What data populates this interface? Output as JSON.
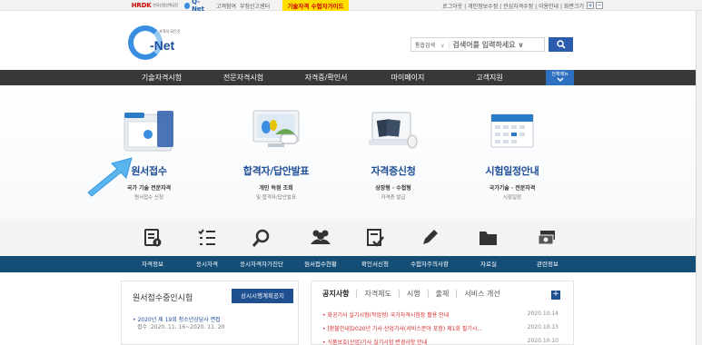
{
  "topbar": {
    "hrdk_logo": "HRDK",
    "hrdk_sub": "한국산업인력공단",
    "qnet_small": "Q-Net",
    "links": [
      "고객참여",
      "부정신고센터"
    ],
    "highlight": "기술자격 수험자가이드",
    "right_links": "로그아웃 | 개인정보수정 | 관심자격수정 | 이용안내 | 화면크기",
    "font_plus": "+",
    "font_minus": "−"
  },
  "logo": {
    "tagline": "자격의 모든것",
    "name": "-Net"
  },
  "search": {
    "scope": "통합검색",
    "scope_arrow": "∨",
    "placeholder": "검색어를 입력하세요 ∨"
  },
  "nav": {
    "items": [
      "기술자격시험",
      "전문자격시험",
      "자격증/확인서",
      "마이페이지",
      "고객지원"
    ],
    "all_menu": "전체메뉴"
  },
  "hero": [
    {
      "title": "원서접수",
      "sub1": "국가 기술 전문자격",
      "sub2": "원서접수 신청"
    },
    {
      "title": "합격자/답안발표",
      "sub1": "개인 득점 조회",
      "sub2": "및 합격자/답안발표"
    },
    {
      "title": "자격증신청",
      "sub1": "상장형 · 수첩형",
      "sub2": "자격증 발급"
    },
    {
      "title": "시험일정안내",
      "sub1": "국가기술 · 전문자격",
      "sub2": "시험일정"
    }
  ],
  "icon_menu": {
    "icons": [
      "info-icon",
      "list-icon",
      "magnifier-icon",
      "people-icon",
      "check-doc-icon",
      "pencil-icon",
      "folder-icon",
      "tickets-icon"
    ],
    "labels": [
      "자격정보",
      "응시자격",
      "응시자격자가진단",
      "원서접수현황",
      "확인서신청",
      "수험자주의사항",
      "자료실",
      "관련정보"
    ]
  },
  "left_panel": {
    "title": "원서접수중인시험",
    "button": "상시시행계획공지",
    "item": "• 2020년 제 19회 청소년상담사 면접",
    "item_period": "접수 :2020. 11. 16~2020. 11. 20"
  },
  "right_panel": {
    "tabs": [
      "공지사항",
      "자격제도",
      "시행",
      "출제",
      "서비스 개선"
    ],
    "plus": "+",
    "notices": [
      {
        "title": "• 화공기사 실기시험(작업형) 국가자격시험장 활용 안내",
        "date": "2020.10.14"
      },
      {
        "title": "• [환불안내]2020년 기사·산업기사(서비스분야 포함) 제1회 필기시...",
        "date": "2020.10.13"
      },
      {
        "title": "• 식품보호(산업)기사 실기시험 변경사항 안내",
        "date": "2020.10.10"
      }
    ]
  }
}
